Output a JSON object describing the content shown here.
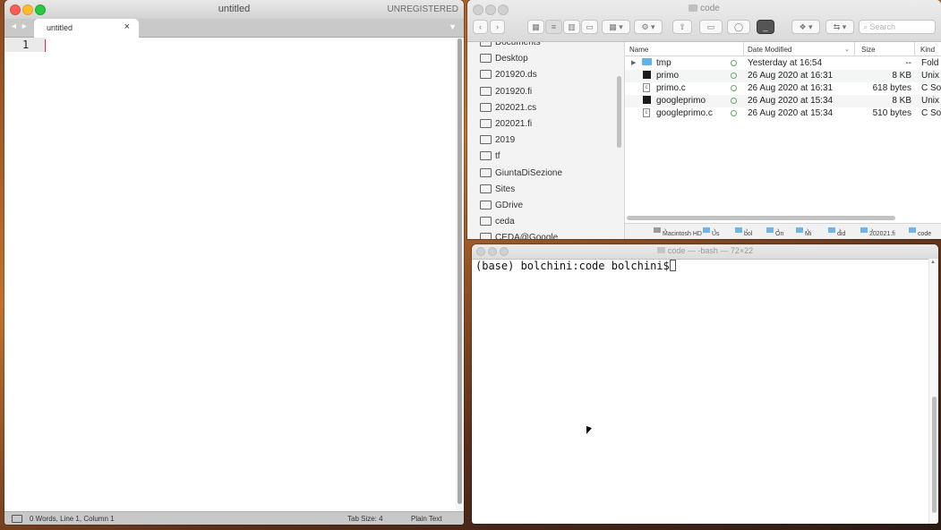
{
  "sublime": {
    "title": "untitled",
    "unregistered": "UNREGISTERED",
    "tab_label": "untitled",
    "tab_close": "×",
    "tab_nav": "◂ ▸",
    "tab_menu": "▼",
    "line_number": "1",
    "status": {
      "words": "0 Words, Line 1, Column 1",
      "tab_size": "Tab Size: 4",
      "syntax": "Plain Text"
    }
  },
  "finder": {
    "title": "code",
    "search_placeholder": "Search",
    "sidebar": [
      "Documents",
      "Desktop",
      "201920.ds",
      "201920.fi",
      "202021.cs",
      "202021.fi",
      "2019",
      "tf",
      "GiuntaDiSezione",
      "Sites",
      "GDrive",
      "ceda",
      "CEDA@Google"
    ],
    "columns": {
      "name": "Name",
      "date": "Date Modified",
      "size": "Size",
      "kind": "Kind"
    },
    "files": [
      {
        "name": "tmp",
        "date": "Yesterday at 16:54",
        "size": "--",
        "kind": "Fold",
        "type": "folder"
      },
      {
        "name": "primo",
        "date": "26 Aug 2020 at 16:31",
        "size": "8 KB",
        "kind": "Unix",
        "type": "exec"
      },
      {
        "name": "primo.c",
        "date": "26 Aug 2020 at 16:31",
        "size": "618 bytes",
        "kind": "C So",
        "type": "c"
      },
      {
        "name": "googleprimo",
        "date": "26 Aug 2020 at 15:34",
        "size": "8 KB",
        "kind": "Unix",
        "type": "exec"
      },
      {
        "name": "googleprimo.c",
        "date": "26 Aug 2020 at 15:34",
        "size": "510 bytes",
        "kind": "C So",
        "type": "c"
      }
    ],
    "path": [
      "Macintosh HD",
      "Us",
      "bol",
      "On",
      "Mi",
      "did",
      "202021.fi",
      "code"
    ]
  },
  "terminal": {
    "title": "code — -bash — 72×22",
    "prompt": "(base) bolchini:code bolchini$ "
  }
}
